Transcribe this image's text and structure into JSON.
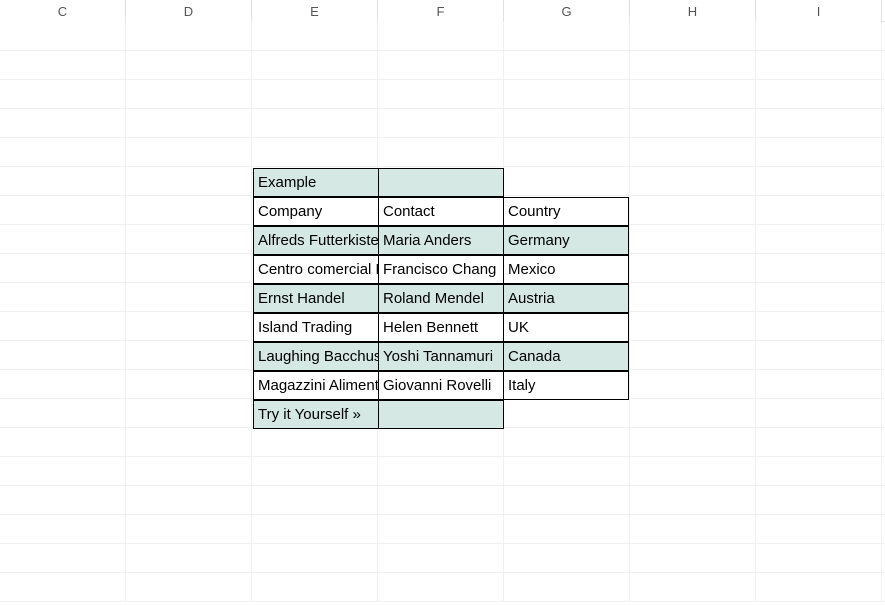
{
  "columns": [
    "C",
    "D",
    "E",
    "F",
    "G",
    "H",
    "I"
  ],
  "blankRowsBefore": 5,
  "blankRowsAfter": 11,
  "table": {
    "titleRow": [
      "Example"
    ],
    "headerRow": [
      "Company",
      "Contact",
      "Country"
    ],
    "dataRows": [
      [
        "Alfreds Futterkiste",
        "Maria Anders",
        "Germany"
      ],
      [
        "Centro comercial Moctezuma",
        "Francisco Chang",
        "Mexico"
      ],
      [
        "Ernst Handel",
        "Roland Mendel",
        "Austria"
      ],
      [
        "Island Trading",
        "Helen Bennett",
        "UK"
      ],
      [
        "Laughing Bacchus Winecellars",
        "Yoshi Tannamuri",
        "Canada"
      ],
      [
        "Magazzini Alimentari Riuniti",
        "Giovanni Rovelli",
        "Italy"
      ]
    ],
    "footerRow": [
      "Try it Yourself »"
    ]
  }
}
